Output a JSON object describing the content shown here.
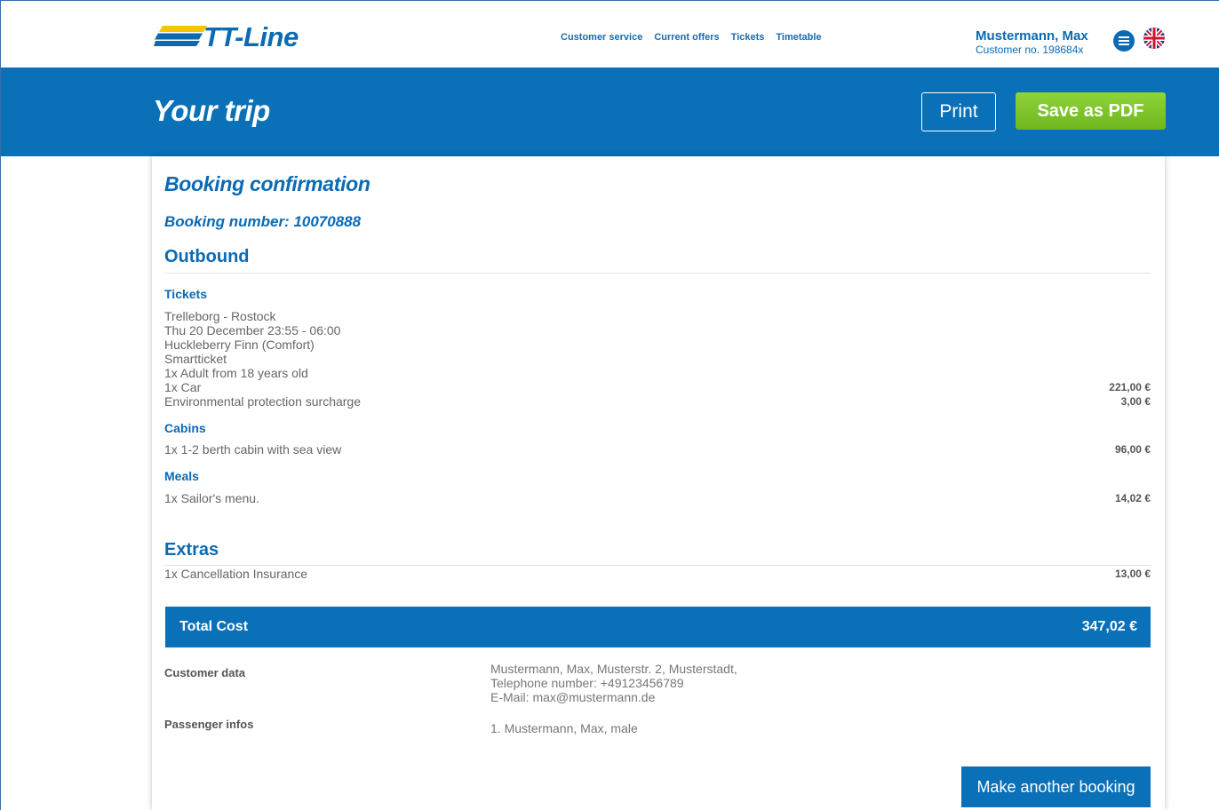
{
  "header": {
    "logo_text": "TT-Line",
    "nav": [
      "Customer service",
      "Current offers",
      "Tickets",
      "Timetable"
    ],
    "user_name": "Mustermann, Max",
    "customer_no": "Customer no. 198684x"
  },
  "banner": {
    "title": "Your trip",
    "print_label": "Print",
    "pdf_label": "Save as PDF"
  },
  "booking": {
    "confirmation_title": "Booking confirmation",
    "booking_number": "Booking number: 10070888",
    "outbound_title": "Outbound",
    "tickets_title": "Tickets",
    "ticket_lines": [
      "Trelleborg - Rostock",
      "Thu 20 December 23:55 - 06:00",
      "Huckleberry Finn (Comfort)",
      "Smartticket",
      "1x Adult from 18 years old",
      "1x Car",
      "Environmental protection surcharge"
    ],
    "ticket_prices": [
      "221,00 €",
      "3,00 €"
    ],
    "cabins_title": "Cabins",
    "cabin_line": "1x 1-2 berth cabin with sea view",
    "cabin_price": "96,00 €",
    "meals_title": "Meals",
    "meal_line": "1x Sailor's menu.",
    "meal_price": "14,02 €",
    "extras_title": "Extras",
    "extra_line": "1x Cancellation Insurance",
    "extra_price": "13,00 €",
    "total_label": "Total Cost",
    "total_value": "347,02 €"
  },
  "customer": {
    "customer_label": "Customer data",
    "customer_lines": [
      "Mustermann, Max, Musterstr. 2, Musterstadt,",
      "Telephone number: +49123456789",
      "E-Mail: max@mustermann.de"
    ],
    "passenger_label": "Passenger infos",
    "passenger_line": "1.  Mustermann, Max, male"
  },
  "actions": {
    "another_label": "Make another booking"
  },
  "colors": {
    "brand_blue": "#0a70b8",
    "pdf_green": "#7cc22a",
    "logo_yellow": "#f5c400"
  }
}
